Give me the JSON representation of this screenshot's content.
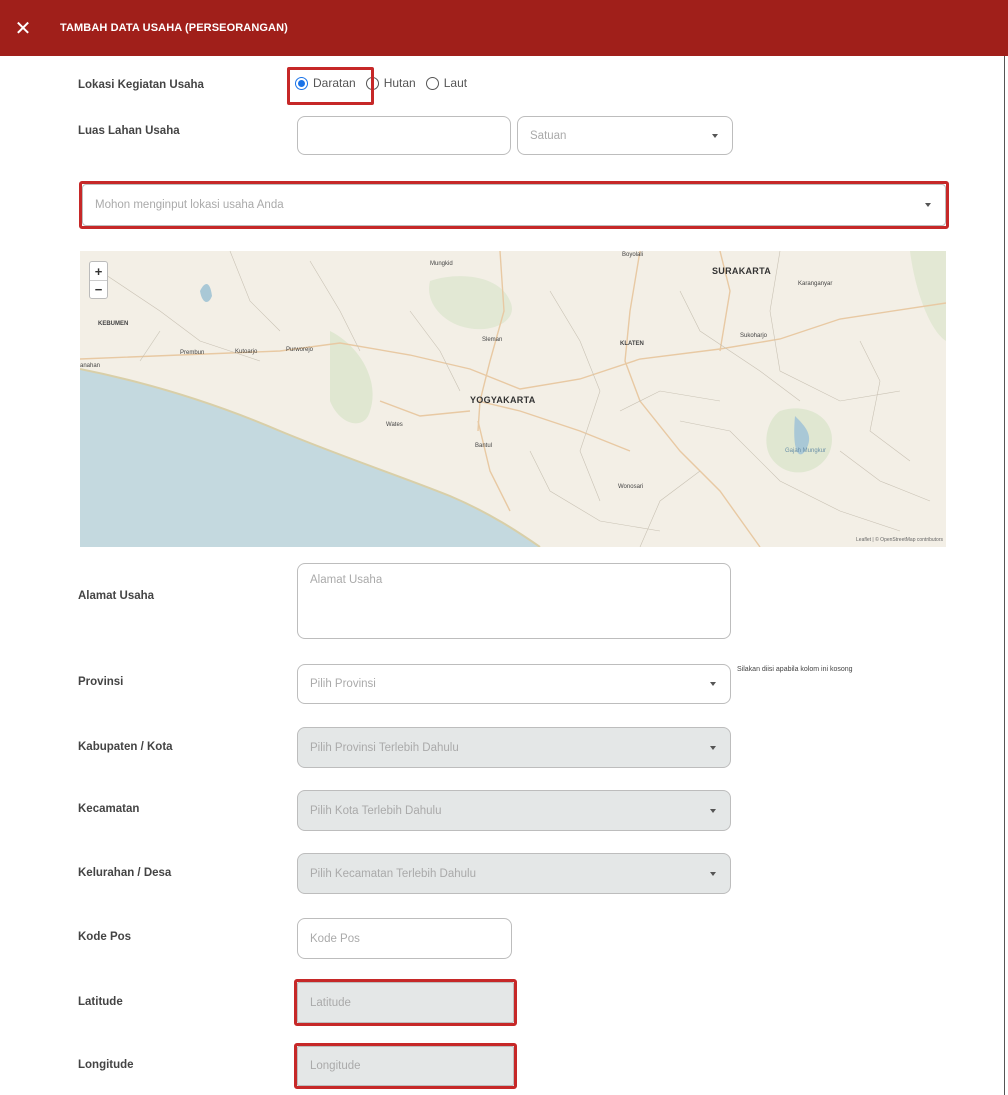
{
  "header": {
    "title": "TAMBAH DATA USAHA (PERSEORANGAN)",
    "close_icon": "close-icon"
  },
  "form": {
    "lokasi_label": "Lokasi Kegiatan Usaha",
    "lokasi_options": [
      "Daratan",
      "Hutan",
      "Laut"
    ],
    "lokasi_selected": "Daratan",
    "luas_label": "Luas Lahan Usaha",
    "luas_value": "",
    "satuan_placeholder": "Satuan",
    "lokasi_search_placeholder": "Mohon menginput lokasi usaha Anda",
    "alamat_label": "Alamat Usaha",
    "alamat_placeholder": "Alamat Usaha",
    "provinsi_label": "Provinsi",
    "provinsi_placeholder": "Pilih Provinsi",
    "provinsi_hint": "Silakan diisi apabila kolom ini kosong",
    "kabupaten_label": "Kabupaten / Kota",
    "kabupaten_placeholder": "Pilih Provinsi Terlebih Dahulu",
    "kecamatan_label": "Kecamatan",
    "kecamatan_placeholder": "Pilih Kota Terlebih Dahulu",
    "kelurahan_label": "Kelurahan / Desa",
    "kelurahan_placeholder": "Pilih Kecamatan Terlebih Dahulu",
    "kodepos_label": "Kode Pos",
    "kodepos_placeholder": "Kode Pos",
    "latitude_label": "Latitude",
    "latitude_placeholder": "Latitude",
    "longitude_label": "Longitude",
    "longitude_placeholder": "Longitude"
  },
  "map": {
    "zoom_in": "+",
    "zoom_out": "−",
    "labels": {
      "surakarta": "SURAKARTA",
      "yogyakarta": "YOGYAKARTA",
      "kebumen": "KEBUMEN",
      "klaten": "KLATEN",
      "mungkid": "Mungkid",
      "boyolali": "Boyolali",
      "karanganyar": "Karanganyar",
      "sukoharjo": "Sukoharjo",
      "sleman": "Sleman",
      "prembun": "Prembun",
      "kutoarjo": "Kutoarjo",
      "purworejo": "Purworejo",
      "wates": "Wates",
      "bantul": "Bantul",
      "wonosari": "Wonosari",
      "gajah_mungkur": "Gajah Mungkur",
      "anahan": "anahan"
    },
    "attribution": "Leaflet | © OpenStreetMap contributors"
  },
  "colors": {
    "header_bg": "#a01f1a",
    "highlight": "#c62828",
    "radio_accent": "#1a73e8",
    "disabled_bg": "#e4e7e7",
    "sea": "#c4d9df"
  }
}
